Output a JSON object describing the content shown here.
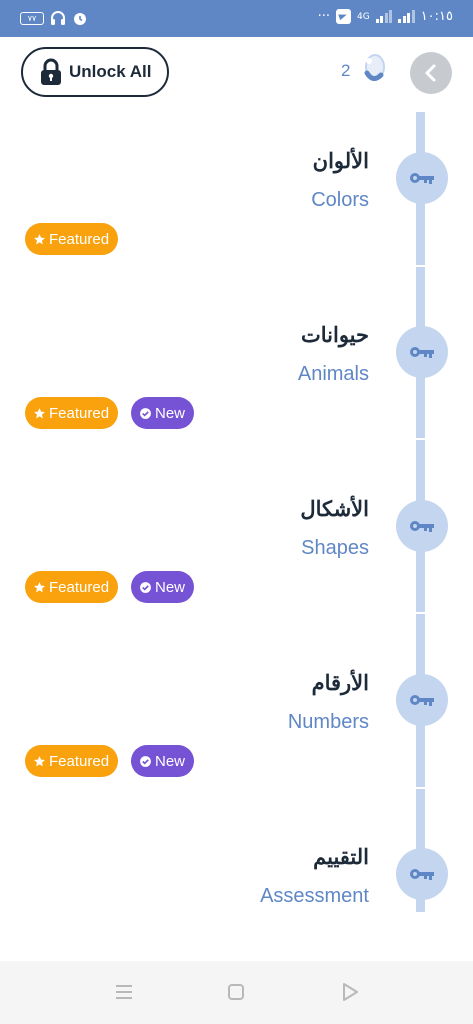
{
  "status_bar": {
    "battery": "٧٧",
    "time": "١٠:١٥",
    "network": "4G",
    "more": "···"
  },
  "header": {
    "unlock_label": "Unlock All",
    "key_count": "2"
  },
  "lessons": [
    {
      "arabic": "الألوان",
      "english": "Colors",
      "badges": [
        "Featured"
      ]
    },
    {
      "arabic": "حيوانات",
      "english": "Animals",
      "badges": [
        "Featured",
        "New"
      ]
    },
    {
      "arabic": "الأشكال",
      "english": "Shapes",
      "badges": [
        "Featured",
        "New"
      ]
    },
    {
      "arabic": "الأرقام",
      "english": "Numbers",
      "badges": [
        "Featured",
        "New"
      ]
    },
    {
      "arabic": "التقييم",
      "english": "Assessment",
      "badges": []
    }
  ],
  "badge_labels": {
    "featured": "Featured",
    "new": "New"
  },
  "colors": {
    "status_bar": "#5f87c6",
    "accent": "#5f87c6",
    "featured": "#f9a20d",
    "new": "#7652d4",
    "timeline": "#c3d5ef",
    "text_dark": "#1d2a3a"
  },
  "icons": [
    "lock-icon",
    "key-icon",
    "chevron-left-icon",
    "star-icon",
    "verified-icon",
    "menu-icon",
    "home-icon",
    "back-icon"
  ]
}
